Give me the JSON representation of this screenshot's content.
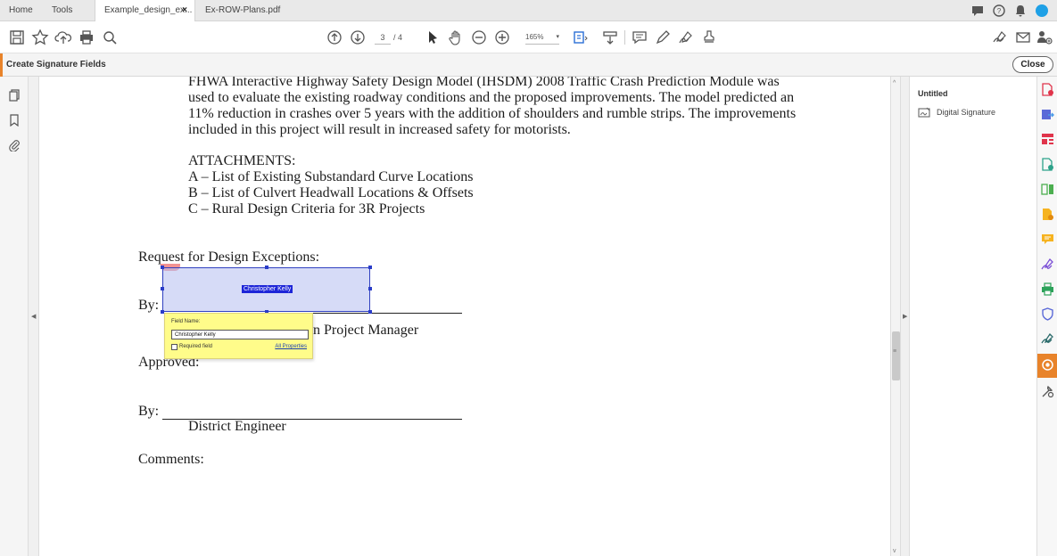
{
  "tabs": [
    {
      "label": "Home"
    },
    {
      "label": "Tools"
    },
    {
      "label": "Example_design_ex...",
      "close": "×"
    },
    {
      "label": "Ex-ROW-Plans.pdf"
    }
  ],
  "toolbar": {
    "page_current": "3",
    "page_total": "/ 4",
    "zoom": "165%"
  },
  "tool_header": {
    "title": "Create Signature Fields",
    "close_label": "Close"
  },
  "document": {
    "para": [
      "FHWA Interactive Highway Safety Design Model (IHSDM) 2008 Traffic Crash Prediction Module was",
      "used to evaluate the existing roadway conditions and the proposed improvements. The model predicted an",
      "11% reduction in crashes over 5 years with the addition of shoulders and rumble strips.  The improvements",
      "included in this project will result in increased safety for motorists."
    ],
    "attachments_heading": "ATTACHMENTS:",
    "attachments": [
      "A – List of Existing Substandard Curve Locations",
      "B – List of Culvert Headwall Locations & Offsets",
      "C – Rural Design Criteria for 3R Projects"
    ],
    "request": "Request for Design Exceptions:",
    "by1": "By:",
    "role1_visible": "n Project Manager",
    "approved": "Approved:",
    "by2": "By:",
    "role2": "District Engineer",
    "comments": "Comments:"
  },
  "signature_field": {
    "name": "Christopher Kelly"
  },
  "field_popup": {
    "label": "Field Name:",
    "value": "Christopher Kelly",
    "required_label": "Required field",
    "all_properties": "All Properties"
  },
  "fields_panel": {
    "title": "Untitled",
    "items": [
      {
        "label": "Digital Signature"
      }
    ]
  },
  "colors": {
    "accent": "#e8832a",
    "field_fill": "#b4bef0",
    "field_border": "#3040c0",
    "popup_bg": "#fffc8a"
  }
}
